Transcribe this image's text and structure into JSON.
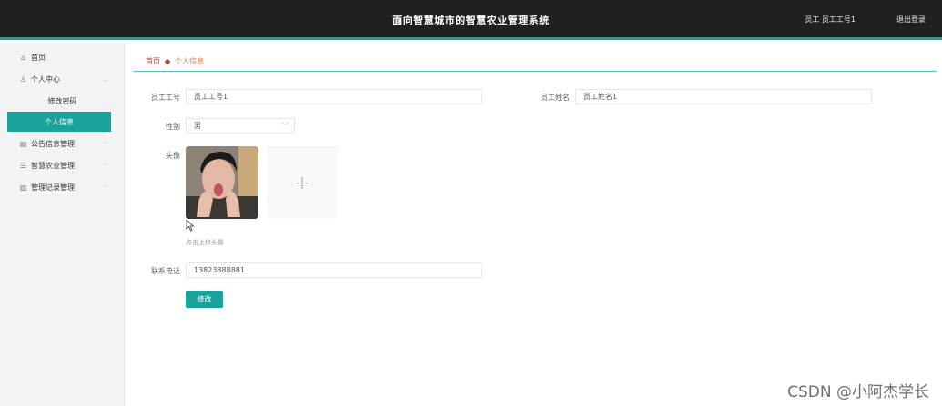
{
  "header": {
    "title": "面向智慧城市的智慧农业管理系统",
    "user_info": "员工 员工工号1",
    "logout": "退出登录"
  },
  "sidebar": {
    "items": [
      {
        "label": "首页",
        "icon": "home-icon"
      },
      {
        "label": "个人中心",
        "icon": "user-icon"
      },
      {
        "label": "修改密码",
        "icon": ""
      },
      {
        "label": "个人信息",
        "icon": "",
        "active": true
      },
      {
        "label": "公告信息管理",
        "icon": "notice-icon"
      },
      {
        "label": "智慧农业管理",
        "icon": "list-icon"
      },
      {
        "label": "管理记录管理",
        "icon": "chart-icon"
      }
    ]
  },
  "breadcrumb": {
    "home": "首页",
    "current": "个人信息"
  },
  "form": {
    "employee_no_label": "员工工号",
    "employee_no_value": "员工工号1",
    "employee_name_label": "员工姓名",
    "employee_name_value": "员工姓名1",
    "gender_label": "性别",
    "gender_value": "男",
    "avatar_label": "头像",
    "avatar_hint": "点击上传头像",
    "phone_label": "联系电话",
    "phone_value": "13823888881",
    "submit_label": "修改"
  },
  "watermark": "CSDN @小阿杰学长",
  "colors": {
    "accent": "#1aa39a",
    "header_bg": "#1f2022"
  }
}
